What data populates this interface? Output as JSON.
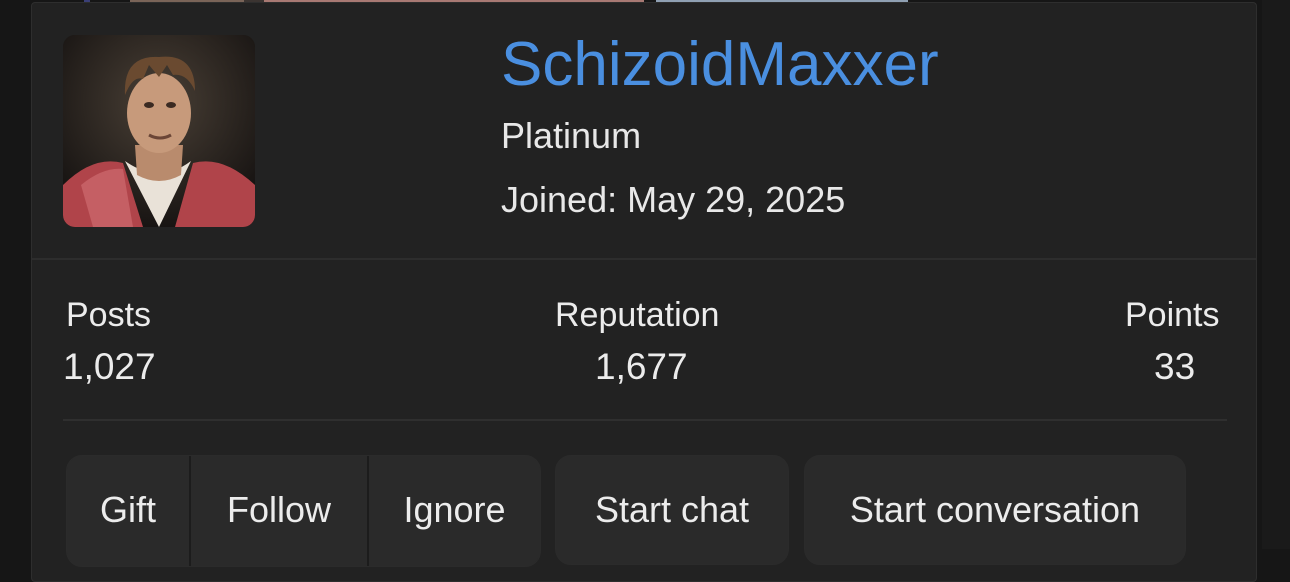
{
  "profile": {
    "username": "SchizoidMaxxer",
    "title": "Platinum",
    "joined": "Joined: May 29, 2025"
  },
  "stats": [
    {
      "label": "Posts",
      "value": "1,027"
    },
    {
      "label": "Reputation",
      "value": "1,677"
    },
    {
      "label": "Points",
      "value": "33"
    }
  ],
  "actions": {
    "gift": "Gift",
    "follow": "Follow",
    "ignore": "Ignore",
    "start_chat": "Start chat",
    "start_conversation": "Start conversation"
  },
  "colors": {
    "username": "#4a8fe0",
    "card_background": "#222222",
    "page_background": "#161616",
    "button_background": "#2a2a2a"
  }
}
